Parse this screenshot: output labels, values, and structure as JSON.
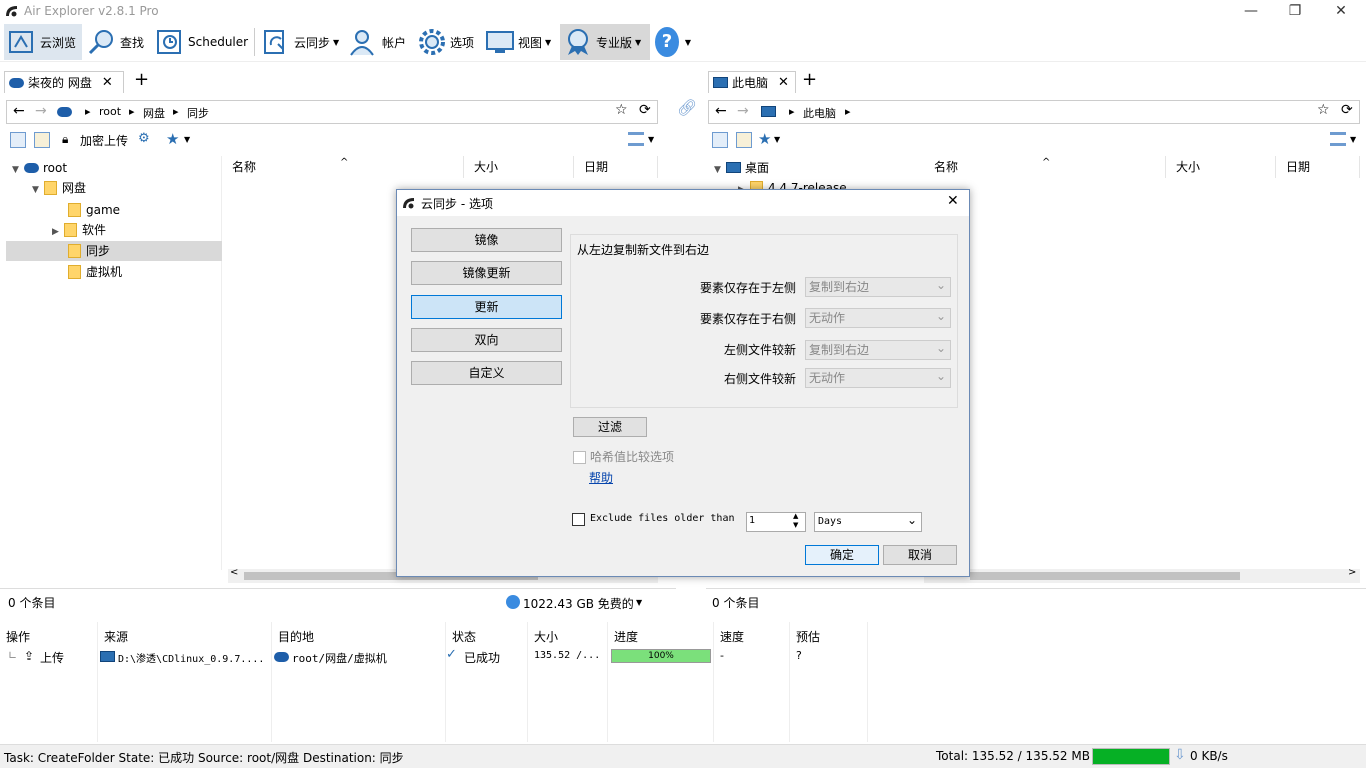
{
  "app": {
    "title": "Air Explorer v2.8.1 Pro"
  },
  "window_controls": {
    "minimize": "—",
    "restore": "❐",
    "close": "✕"
  },
  "toolbar": {
    "items": [
      "云浏览",
      "查找",
      "Scheduler",
      "云同步",
      "帐户",
      "选项",
      "视图",
      "专业版",
      "?"
    ]
  },
  "left_pane": {
    "tab": "柒夜的 网盘",
    "breadcrumb": [
      "root",
      "网盘",
      "同步"
    ],
    "encrypt_upload": "加密上传",
    "tree": [
      "root",
      "网盘",
      "game",
      "软件",
      "同步",
      "虚拟机"
    ],
    "columns": [
      "名称",
      "大小",
      "日期"
    ],
    "status_count": "0 个条目",
    "free_space": "1022.43 GB 免费的"
  },
  "right_pane": {
    "tab": "此电脑",
    "breadcrumb": [
      "此电脑"
    ],
    "tree": [
      "桌面",
      "4.4.7-release"
    ],
    "columns": [
      "名称",
      "大小",
      "日期"
    ],
    "status_count": "0 个条目"
  },
  "dialog": {
    "title": "云同步 - 选项",
    "modes": [
      "镜像",
      "镜像更新",
      "更新",
      "双向",
      "自定义"
    ],
    "active_mode": "更新",
    "description": "从左边复制新文件到右边",
    "rules": [
      {
        "label": "要素仅存在于左侧",
        "value": "复制到右边"
      },
      {
        "label": "要素仅存在于右侧",
        "value": "无动作"
      },
      {
        "label": "左侧文件较新",
        "value": "复制到右边"
      },
      {
        "label": "右侧文件较新",
        "value": "无动作"
      }
    ],
    "filter_button": "过滤",
    "hash_option": "哈希值比较选项",
    "help_link": "帮助",
    "exclude_label": "Exclude files older than",
    "exclude_value": "1",
    "exclude_unit": "Days",
    "ok": "确定",
    "cancel": "取消"
  },
  "transfers": {
    "columns": [
      "操作",
      "来源",
      "目的地",
      "状态",
      "大小",
      "进度",
      "速度",
      "预估"
    ],
    "rows": [
      {
        "op": "上传",
        "source": "D:\\渗透\\CDlinux_0.9.7....",
        "dest": "root/网盘/虚拟机",
        "status": "已成功",
        "size": "135.52 /...",
        "progress_text": "100%",
        "progress": 100,
        "speed": "-",
        "eta": "?"
      }
    ]
  },
  "statusbar": {
    "task": "Task: CreateFolder State: 已成功 Source: root/网盘 Destination: 同步",
    "total": "Total: 135.52 / 135.52 MB",
    "speed": "0 KB/s",
    "overall_progress": 100
  },
  "colors": {
    "accent": "#0078d7",
    "progress_green": "#06b025",
    "cloud_blue": "#1e5ea9"
  }
}
